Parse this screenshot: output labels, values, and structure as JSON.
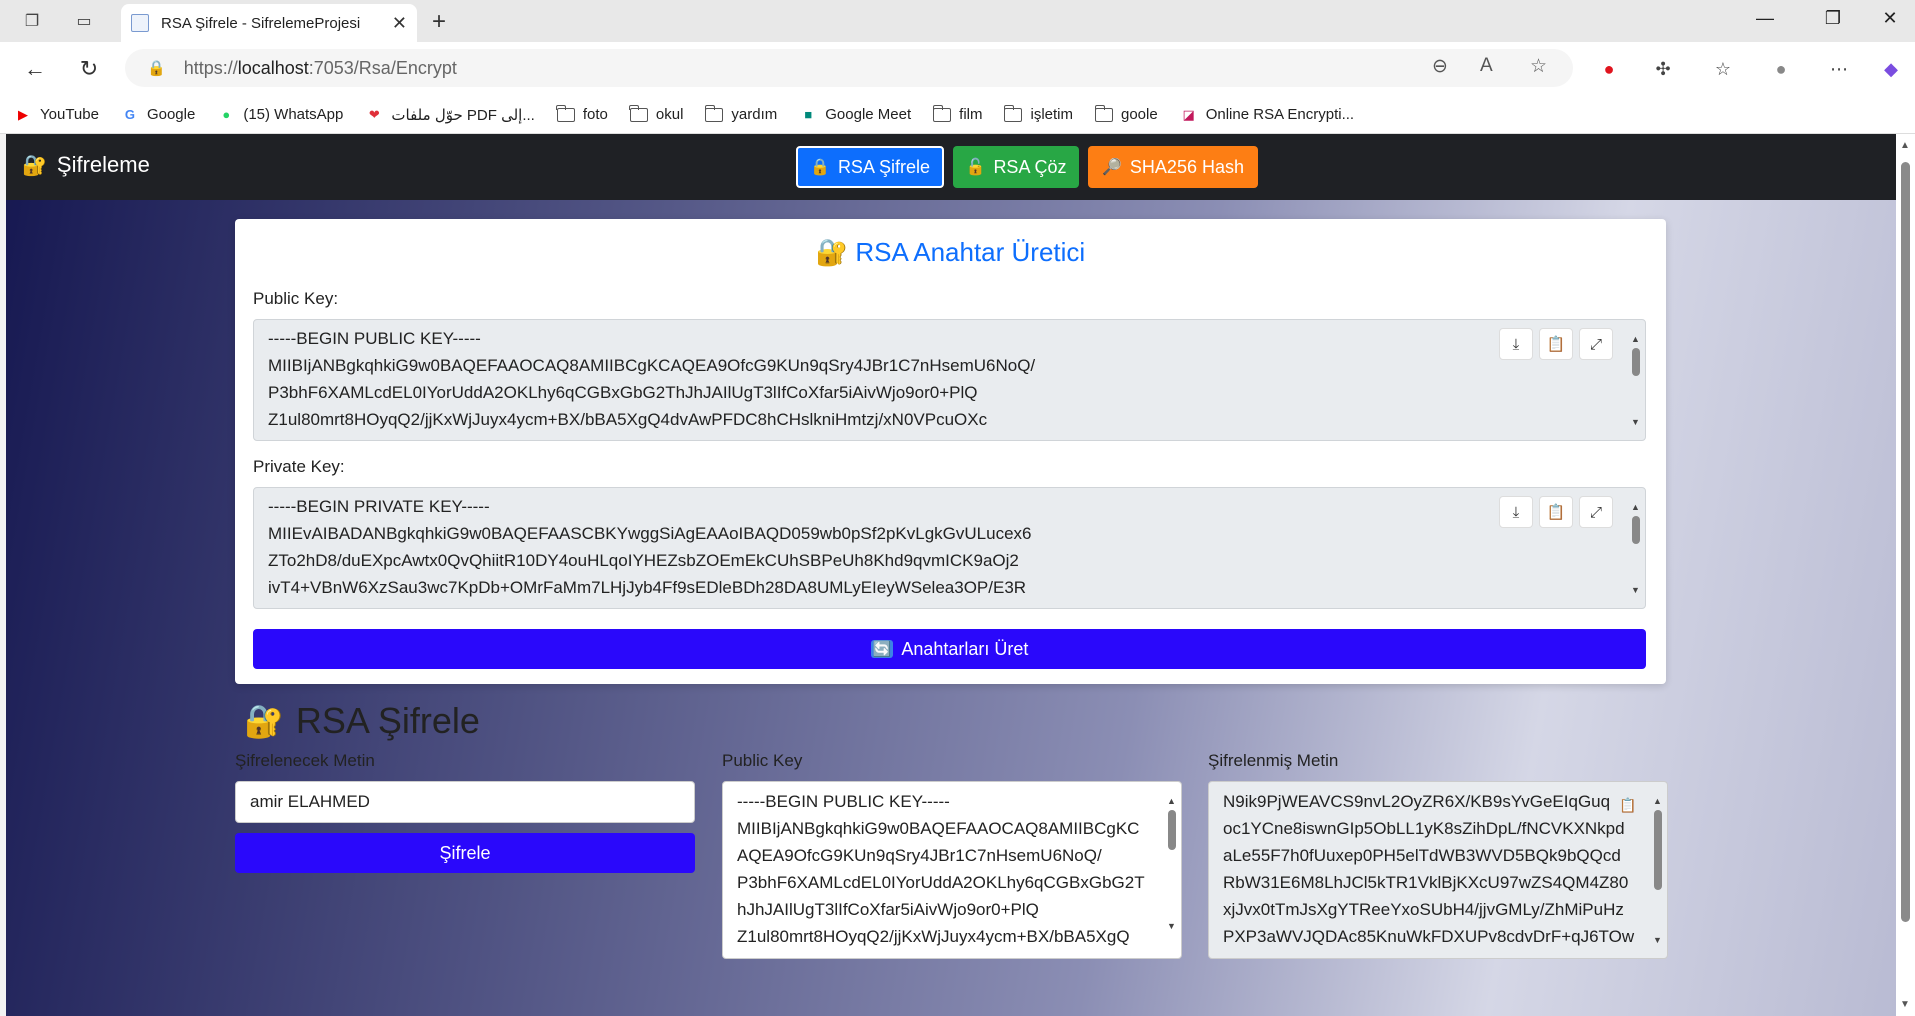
{
  "browser": {
    "tab_title": "RSA Şifrele - SifrelemeProjesi",
    "url_prefix": "https://",
    "url_host": "localhost",
    "url_path": ":7053/Rsa/Encrypt",
    "bookmarks": [
      {
        "label": "YouTube",
        "icon": "youtube-icon"
      },
      {
        "label": "Google",
        "icon": "google-icon"
      },
      {
        "label": "(15) WhatsApp",
        "icon": "whatsapp-icon"
      },
      {
        "label": "حوّل ملفات PDF إلى...",
        "icon": "heart-icon"
      },
      {
        "label": "foto",
        "icon": "folder-icon"
      },
      {
        "label": "okul",
        "icon": "folder-icon"
      },
      {
        "label": "yardım",
        "icon": "folder-icon"
      },
      {
        "label": "Google Meet",
        "icon": "meet-icon"
      },
      {
        "label": "film",
        "icon": "folder-icon"
      },
      {
        "label": "işletim",
        "icon": "folder-icon"
      },
      {
        "label": "goole",
        "icon": "folder-icon"
      },
      {
        "label": "Online RSA Encrypti...",
        "icon": "rsa-site-icon"
      }
    ]
  },
  "nav": {
    "brand": "Şifreleme",
    "buttons": [
      {
        "label": "RSA Şifrele",
        "color": "#0d6efd"
      },
      {
        "label": "RSA Çöz",
        "color": "#28a745"
      },
      {
        "label": "SHA256 Hash",
        "color": "#fd7e14"
      }
    ]
  },
  "keygen": {
    "title": "RSA Anahtar Üretici",
    "public_label": "Public Key:",
    "private_label": "Private Key:",
    "public_lines": [
      "-----BEGIN PUBLIC KEY-----",
      "MIIBIjANBgkqhkiG9w0BAQEFAAOCAQ8AMIIBCgKCAQEA9OfcG9KUn9qSry4JBr1C7nHsemU6NoQ/",
      "P3bhF6XAMLcdEL0IYorUddA2OKLhy6qCGBxGbG2ThJhJAIlUgT3lIfCoXfar5iAivWjo9or0+PlQ",
      "Z1ul80mrt8HOyqQ2/jjKxWjJuyx4ycm+BX/bBA5XgQ4dvAwPFDC8hCHslkniHmtzj/xN0VPcuOXc"
    ],
    "private_lines": [
      "-----BEGIN PRIVATE KEY-----",
      "MIIEvAIBADANBgkqhkiG9w0BAQEFAASCBKYwggSiAgEAAoIBAQD059wb0pSf2pKvLgkGvULucex6",
      "ZTo2hD8/duEXpcAwtx0QvQhiitR10DY4ouHLqoIYHEZsbZOEmEkCUhSBPeUh8Khd9qvmICK9aOj2",
      "ivT4+VBnW6XzSau3wc7KpDb+OMrFaMm7LHjJyb4Ff9sEDleBDh28DA8UMLyEIeyWSelea3OP/E3R"
    ],
    "generate_label": "Anahtarları Üret"
  },
  "encrypt": {
    "title": "RSA Şifrele",
    "text_label": "Şifrelenecek Metin",
    "text_value": "amir ELAHMED",
    "encrypt_button": "Şifrele",
    "pubkey_label": "Public Key",
    "pubkey_lines": [
      "-----BEGIN PUBLIC KEY-----",
      "MIIBIjANBgkqhkiG9w0BAQEFAAOCAQ8AMIIBCgKC",
      "AQEA9OfcG9KUn9qSry4JBr1C7nHsemU6NoQ/",
      "P3bhF6XAMLcdEL0IYorUddA2OKLhy6qCGBxGbG2T",
      "hJhJAIlUgT3lIfCoXfar5iAivWjo9or0+PlQ",
      "Z1ul80mrt8HOyqQ2/jjKxWjJuyx4ycm+BX/bBA5XgQ"
    ],
    "output_label": "Şifrelenmiş Metin",
    "output_lines": [
      "N9ik9PjWEAVCS9nvL2OyZR6X/KB9sYvGeEIqGuq",
      "oc1YCne8iswnGIp5ObLL1yK8sZihDpL/fNCVKXNkpd",
      "aLe55F7h0fUuxep0PH5elTdWB3WVD5BQk9bQQcd",
      "RbW31E6M8LhJCl5kTR1VklBjKXcU97wZS4QM4Z80",
      "xjJvx0tTmJsXgYTReeYxoSUbH4/jjvGMLy/ZhMiPuHz",
      "PXP3aWVJQDAc85KnuWkFDXUPv8cdvDrF+qJ6TOw"
    ]
  }
}
